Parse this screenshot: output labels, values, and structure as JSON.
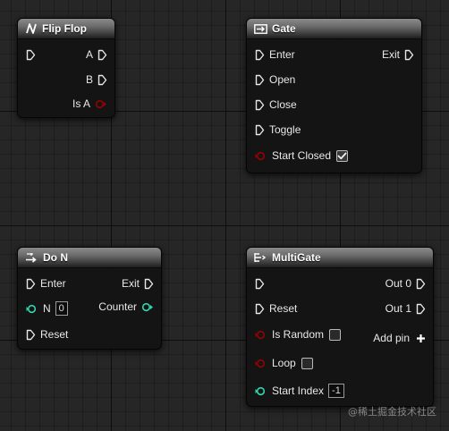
{
  "colors": {
    "exec_pin": "#e6e6e6",
    "bool_pin": "#8c0000",
    "int_pin": "#2fd8b0",
    "header_top": "#8a8a8a",
    "node_body": "#141414",
    "graph_bg": "#262626"
  },
  "nodes": {
    "flip_flop": {
      "title": "Flip Flop",
      "icon": "flip-flop-icon",
      "pins": {
        "a": "A",
        "b": "B",
        "is_a": "Is A"
      }
    },
    "gate": {
      "title": "Gate",
      "icon": "gate-icon",
      "pins": {
        "enter": "Enter",
        "exit": "Exit",
        "open": "Open",
        "close": "Close",
        "toggle": "Toggle",
        "start_closed": "Start Closed"
      },
      "start_closed_checked": true
    },
    "do_n": {
      "title": "Do N",
      "icon": "do-n-icon",
      "pins": {
        "enter": "Enter",
        "exit": "Exit",
        "n": "N",
        "n_value": "0",
        "counter": "Counter",
        "reset": "Reset"
      }
    },
    "multigate": {
      "title": "MultiGate",
      "icon": "multigate-icon",
      "pins": {
        "out0": "Out 0",
        "out1": "Out 1",
        "reset": "Reset",
        "is_random": "Is Random",
        "add_pin": "Add pin",
        "loop": "Loop",
        "start_index": "Start Index",
        "start_index_value": "-1"
      },
      "is_random_checked": false,
      "loop_checked": false
    }
  },
  "watermark": "@稀土掘金技术社区"
}
